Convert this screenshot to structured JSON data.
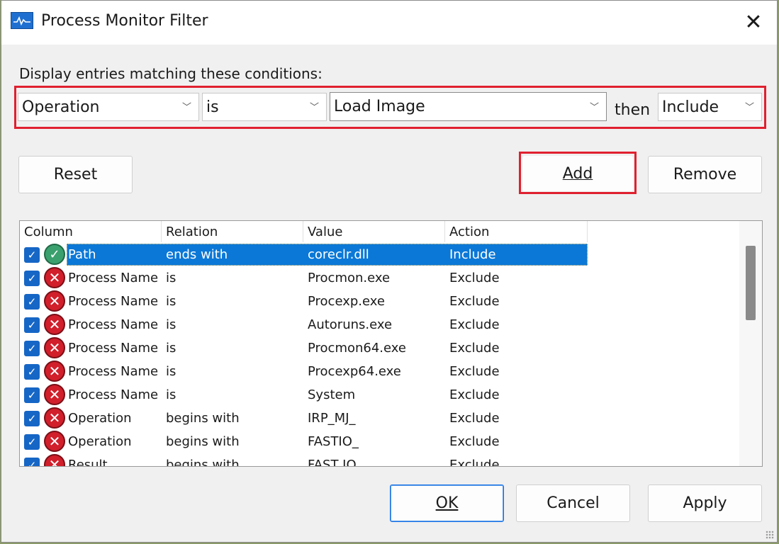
{
  "window": {
    "title": "Process Monitor Filter",
    "close_glyph": "✕"
  },
  "conditions": {
    "label": "Display entries matching these conditions:",
    "column": "Operation",
    "relation": "is",
    "value": "Load Image",
    "then_label": "then",
    "action": "Include"
  },
  "buttons": {
    "reset": "Reset",
    "add": "Add",
    "remove": "Remove",
    "ok": "OK",
    "cancel": "Cancel",
    "apply": "Apply"
  },
  "list": {
    "columns": [
      "Column",
      "Relation",
      "Value",
      "Action"
    ],
    "rows": [
      {
        "column": "Path",
        "relation": "ends with",
        "value": "coreclr.dll",
        "action": "Include",
        "checked": true,
        "selected": true
      },
      {
        "column": "Process Name",
        "relation": "is",
        "value": "Procmon.exe",
        "action": "Exclude",
        "checked": true
      },
      {
        "column": "Process Name",
        "relation": "is",
        "value": "Procexp.exe",
        "action": "Exclude",
        "checked": true
      },
      {
        "column": "Process Name",
        "relation": "is",
        "value": "Autoruns.exe",
        "action": "Exclude",
        "checked": true
      },
      {
        "column": "Process Name",
        "relation": "is",
        "value": "Procmon64.exe",
        "action": "Exclude",
        "checked": true
      },
      {
        "column": "Process Name",
        "relation": "is",
        "value": "Procexp64.exe",
        "action": "Exclude",
        "checked": true
      },
      {
        "column": "Process Name",
        "relation": "is",
        "value": "System",
        "action": "Exclude",
        "checked": true
      },
      {
        "column": "Operation",
        "relation": "begins with",
        "value": "IRP_MJ_",
        "action": "Exclude",
        "checked": true
      },
      {
        "column": "Operation",
        "relation": "begins with",
        "value": "FASTIO_",
        "action": "Exclude",
        "checked": true
      },
      {
        "column": "Result",
        "relation": "begins with",
        "value": "FAST IO",
        "action": "Exclude",
        "checked": true
      }
    ]
  },
  "colors": {
    "highlight": "#e0202f",
    "selection": "#0b78d7",
    "checkbox": "#1666c6",
    "exclude_icon": "#d11f2b",
    "include_icon": "#3aa06e"
  },
  "icons": {
    "app": "process-monitor-icon",
    "close": "close-icon",
    "dropdown": "chevron-down-icon",
    "checkbox": "checkbox-checked-icon",
    "include": "include-check-icon",
    "exclude": "exclude-x-icon"
  }
}
